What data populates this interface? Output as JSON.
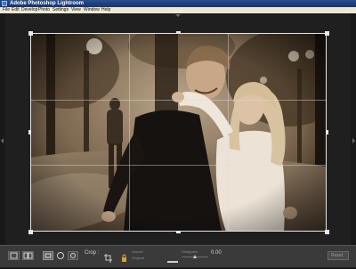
{
  "window": {
    "title": "Adobe Photoshop Lightroom"
  },
  "menu": {
    "items": [
      "File",
      "Edit",
      "Develop",
      "Photo",
      "Settings",
      "View",
      "Window",
      "Help"
    ]
  },
  "toolbar": {
    "crop_label": "Crop :",
    "aspect_label": "Aspect :",
    "aspect_value": "Original",
    "straighten_label": "Straighten",
    "straighten_value": "0.00",
    "reset_label": "Reset"
  },
  "icons": {
    "app": "lightroom-app-icon",
    "loupe": "loupe-view-icon",
    "compare": "compare-view-icon",
    "crop_overlay": "crop-overlay-icon",
    "spot": "spot-removal-icon",
    "redeye": "red-eye-icon",
    "crop_tool": "crop-tool-icon",
    "lock": "lock-icon",
    "straighten": "straighten-tool-icon"
  },
  "colors": {
    "title_bar": "#1f4484",
    "menu_bar": "#ece9d8",
    "workspace": "#1f1f1f",
    "toolbar": "#3a3a3a",
    "crop_frame": "#e8e8e8"
  }
}
